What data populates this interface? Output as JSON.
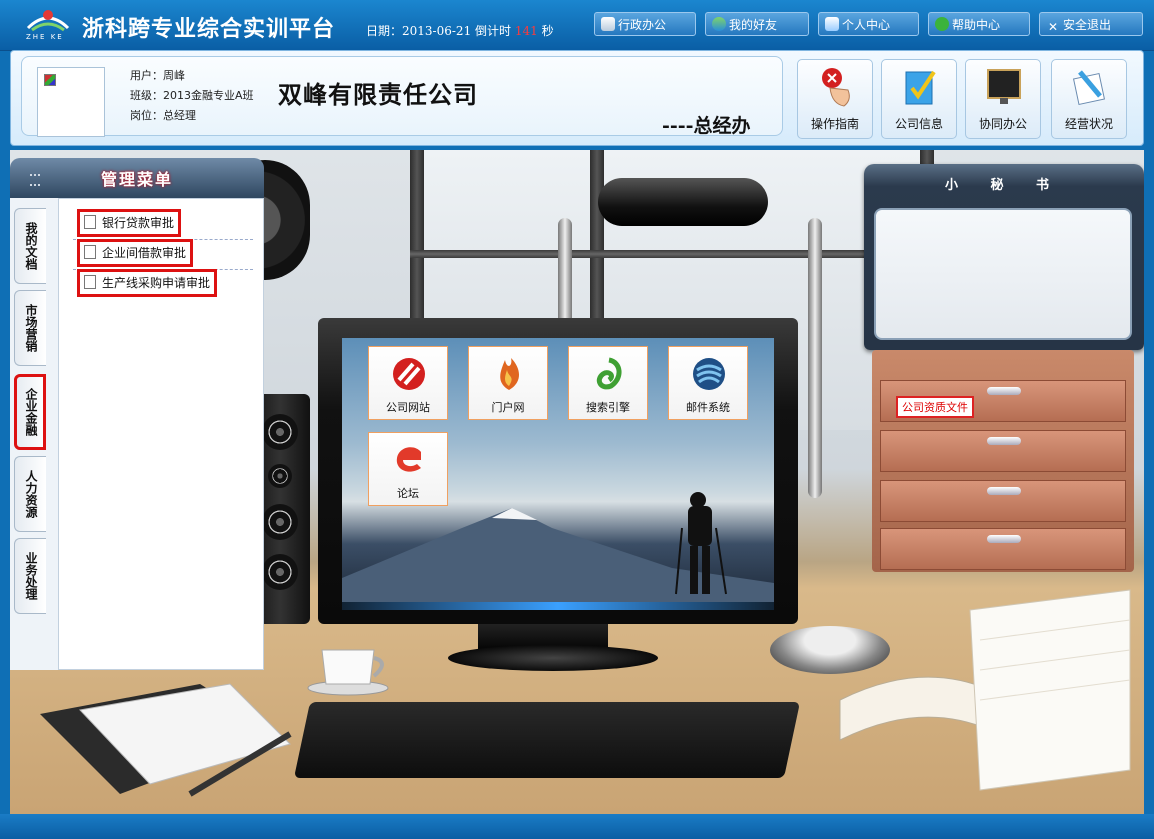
{
  "topbar": {
    "logo_sub": "ZHE KE",
    "title": "浙科跨专业综合实训平台",
    "date_label": "日期：",
    "date": "2013-06-21",
    "countdown_label": "倒计时",
    "countdown": "141",
    "countdown_unit": "秒",
    "nav": [
      {
        "label": "行政办公",
        "icon": "document-icon"
      },
      {
        "label": "我的好友",
        "icon": "friends-icon"
      },
      {
        "label": "个人中心",
        "icon": "home-icon"
      },
      {
        "label": "帮助中心",
        "icon": "help-icon"
      },
      {
        "label": "安全退出",
        "icon": "close-icon"
      }
    ]
  },
  "header": {
    "user_label": "用户：",
    "user": "周峰",
    "class_label": "班级：",
    "class": "2013金融专业A班",
    "post_label": "岗位：",
    "post": "总经理",
    "company": "双峰有限责任公司",
    "department": "----总经办",
    "buttons": [
      {
        "label": "操作指南",
        "icon": "guide-hand-icon"
      },
      {
        "label": "公司信息",
        "icon": "company-info-icon"
      },
      {
        "label": "协同办公",
        "icon": "collab-monitor-icon"
      },
      {
        "label": "经营状况",
        "icon": "business-notebook-icon"
      }
    ]
  },
  "menu": {
    "title": "管理菜单",
    "tabs": [
      "我的文档",
      "市场营销",
      "企业金融",
      "人力资源",
      "业务处理"
    ],
    "active_tab": "企业金融",
    "items": [
      "银行贷款审批",
      "企业间借款审批",
      "生产线采购申请审批"
    ]
  },
  "desktop": {
    "apps": [
      {
        "label": "公司网站",
        "icon": "company-website-icon",
        "color": "#d3201f"
      },
      {
        "label": "门户网",
        "icon": "portal-flame-icon",
        "color": "#e0661f"
      },
      {
        "label": "搜索引擎",
        "icon": "search-engine-icon",
        "color": "#3fa033"
      },
      {
        "label": "邮件系统",
        "icon": "mail-system-icon",
        "color": "#1f4f86"
      },
      {
        "label": "论坛",
        "icon": "forum-icon",
        "color": "#e23a2a"
      }
    ],
    "secretary_title": "小 秘 书",
    "qualification_label": "公司资质文件"
  },
  "colors": {
    "topbar": "#0f6fb5",
    "highlight_red": "#d11111"
  }
}
